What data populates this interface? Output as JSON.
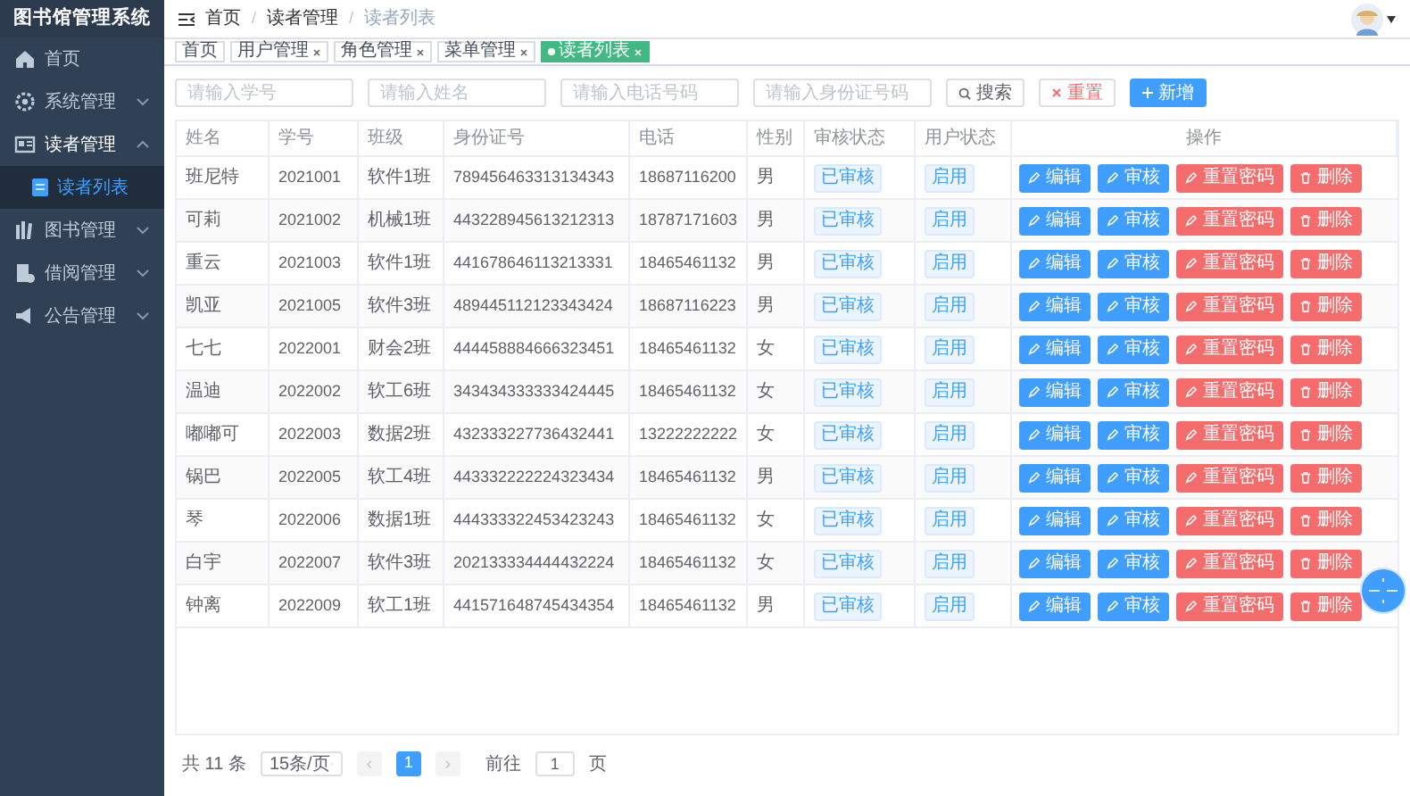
{
  "sidebar": {
    "title": "图书馆管理系统",
    "items": [
      {
        "label": "首页",
        "expanded": false
      },
      {
        "label": "系统管理",
        "expanded": false
      },
      {
        "label": "读者管理",
        "expanded": true,
        "children": [
          {
            "label": "读者列表",
            "selected": true
          }
        ]
      },
      {
        "label": "图书管理",
        "expanded": false
      },
      {
        "label": "借阅管理",
        "expanded": false
      },
      {
        "label": "公告管理",
        "expanded": false
      }
    ]
  },
  "breadcrumb": [
    {
      "label": "首页"
    },
    {
      "separator": "/",
      "label": "读者管理"
    },
    {
      "separator": "/",
      "label": "读者列表"
    }
  ],
  "tags": [
    {
      "label": "首页",
      "closable": false,
      "selected": false
    },
    {
      "label": "用户管理",
      "closable": true,
      "selected": false
    },
    {
      "label": "角色管理",
      "closable": true,
      "selected": false
    },
    {
      "label": "菜单管理",
      "closable": true,
      "selected": false
    },
    {
      "label": "读者列表",
      "closable": true,
      "selected": true
    }
  ],
  "search": {
    "fields": [
      {
        "placeholder": "请输入学号"
      },
      {
        "placeholder": "请输入姓名"
      },
      {
        "placeholder": "请输入电话号码"
      },
      {
        "placeholder": "请输入身份证号码"
      }
    ],
    "buttons": [
      {
        "label": "搜索",
        "kind": "search"
      },
      {
        "label": "重置",
        "kind": "reset"
      },
      {
        "label": "新增",
        "kind": "add"
      }
    ]
  },
  "table": {
    "columns": [
      "姓名",
      "学号",
      "班级",
      "身份证号",
      "电话",
      "性别",
      "审核状态",
      "用户状态",
      "操作"
    ],
    "rows": [
      {
        "cells": [
          "班尼特",
          "2021001",
          "软件1班",
          "789456463313134343",
          "18687116200",
          "男"
        ],
        "audit": "已审核",
        "status": "启用",
        "actions": [
          {
            "label": "编辑",
            "kind": "primary"
          },
          {
            "label": "审核",
            "kind": "primary"
          },
          {
            "label": "重置密码",
            "kind": "danger"
          },
          {
            "label": "删除",
            "kind": "danger"
          }
        ]
      },
      {
        "cells": [
          "可莉",
          "2021002",
          "机械1班",
          "443228945613212313",
          "18787171603",
          "男"
        ],
        "audit": "已审核",
        "status": "启用",
        "actions": [
          {
            "label": "编辑",
            "kind": "primary"
          },
          {
            "label": "审核",
            "kind": "primary"
          },
          {
            "label": "重置密码",
            "kind": "danger"
          },
          {
            "label": "删除",
            "kind": "danger"
          }
        ]
      },
      {
        "cells": [
          "重云",
          "2021003",
          "软件1班",
          "441678646113213331",
          "18465461132",
          "男"
        ],
        "audit": "已审核",
        "status": "启用",
        "actions": [
          {
            "label": "编辑",
            "kind": "primary"
          },
          {
            "label": "审核",
            "kind": "primary"
          },
          {
            "label": "重置密码",
            "kind": "danger"
          },
          {
            "label": "删除",
            "kind": "danger"
          }
        ]
      },
      {
        "cells": [
          "凯亚",
          "2021005",
          "软件3班",
          "489445112123343424",
          "18687116223",
          "男"
        ],
        "audit": "已审核",
        "status": "启用",
        "actions": [
          {
            "label": "编辑",
            "kind": "primary"
          },
          {
            "label": "审核",
            "kind": "primary"
          },
          {
            "label": "重置密码",
            "kind": "danger"
          },
          {
            "label": "删除",
            "kind": "danger"
          }
        ]
      },
      {
        "cells": [
          "七七",
          "2022001",
          "财会2班",
          "444458884666323451",
          "18465461132",
          "女"
        ],
        "audit": "已审核",
        "status": "启用",
        "actions": [
          {
            "label": "编辑",
            "kind": "primary"
          },
          {
            "label": "审核",
            "kind": "primary"
          },
          {
            "label": "重置密码",
            "kind": "danger"
          },
          {
            "label": "删除",
            "kind": "danger"
          }
        ]
      },
      {
        "cells": [
          "温迪",
          "2022002",
          "软工6班",
          "343434333333424445",
          "18465461132",
          "女"
        ],
        "audit": "已审核",
        "status": "启用",
        "actions": [
          {
            "label": "编辑",
            "kind": "primary"
          },
          {
            "label": "审核",
            "kind": "primary"
          },
          {
            "label": "重置密码",
            "kind": "danger"
          },
          {
            "label": "删除",
            "kind": "danger"
          }
        ]
      },
      {
        "cells": [
          "嘟嘟可",
          "2022003",
          "数据2班",
          "432333227736432441",
          "13222222222",
          "女"
        ],
        "audit": "已审核",
        "status": "启用",
        "actions": [
          {
            "label": "编辑",
            "kind": "primary"
          },
          {
            "label": "审核",
            "kind": "primary"
          },
          {
            "label": "重置密码",
            "kind": "danger"
          },
          {
            "label": "删除",
            "kind": "danger"
          }
        ]
      },
      {
        "cells": [
          "锅巴",
          "2022005",
          "软工4班",
          "443332222224323434",
          "18465461132",
          "男"
        ],
        "audit": "已审核",
        "status": "启用",
        "actions": [
          {
            "label": "编辑",
            "kind": "primary"
          },
          {
            "label": "审核",
            "kind": "primary"
          },
          {
            "label": "重置密码",
            "kind": "danger"
          },
          {
            "label": "删除",
            "kind": "danger"
          }
        ]
      },
      {
        "cells": [
          "琴",
          "2022006",
          "数据1班",
          "444333322453423243",
          "18465461132",
          "女"
        ],
        "audit": "已审核",
        "status": "启用",
        "actions": [
          {
            "label": "编辑",
            "kind": "primary"
          },
          {
            "label": "审核",
            "kind": "primary"
          },
          {
            "label": "重置密码",
            "kind": "danger"
          },
          {
            "label": "删除",
            "kind": "danger"
          }
        ]
      },
      {
        "cells": [
          "白宇",
          "2022007",
          "软件3班",
          "202133334444432224",
          "18465461132",
          "女"
        ],
        "audit": "已审核",
        "status": "启用",
        "actions": [
          {
            "label": "编辑",
            "kind": "primary"
          },
          {
            "label": "审核",
            "kind": "primary"
          },
          {
            "label": "重置密码",
            "kind": "danger"
          },
          {
            "label": "删除",
            "kind": "danger"
          }
        ]
      },
      {
        "cells": [
          "钟离",
          "2022009",
          "软工1班",
          "441571648745434354",
          "18465461132",
          "男"
        ],
        "audit": "已审核",
        "status": "启用",
        "actions": [
          {
            "label": "编辑",
            "kind": "primary"
          },
          {
            "label": "审核",
            "kind": "primary"
          },
          {
            "label": "重置密码",
            "kind": "danger"
          },
          {
            "label": "删除",
            "kind": "danger"
          }
        ]
      }
    ]
  },
  "pagination": {
    "total": "共 11 条",
    "page_size": "15条/页",
    "prev": "‹",
    "pages": [
      {
        "label": "1",
        "selected": true
      }
    ],
    "next": "›",
    "goto_label": "前往",
    "goto_value": "1",
    "goto_suffix": "页"
  }
}
